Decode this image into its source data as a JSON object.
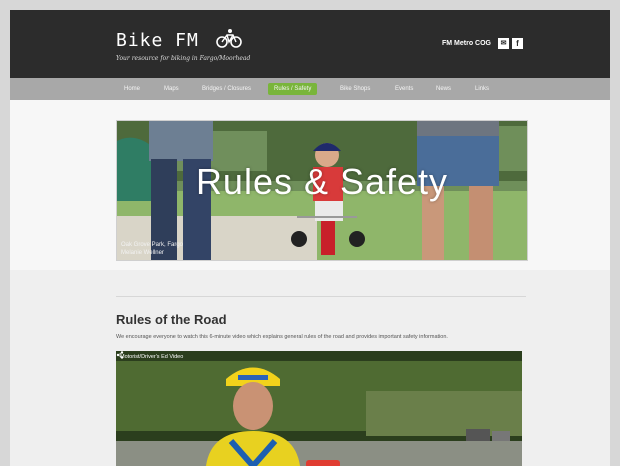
{
  "header": {
    "brand": "Bike FM",
    "tagline": "Your resource for biking in Fargo/Moorhead",
    "org": "FM Metro COG",
    "icons": [
      "bike-icon",
      "mail-icon",
      "facebook-icon"
    ],
    "social_mail_glyph": "✉",
    "social_fb_glyph": "f"
  },
  "nav": {
    "items": [
      {
        "label": "Home"
      },
      {
        "label": "Maps"
      },
      {
        "label": "Bridges / Closures"
      },
      {
        "label": "Rules / Safety"
      },
      {
        "label": "Bike Shops"
      },
      {
        "label": "Events"
      },
      {
        "label": "News"
      },
      {
        "label": "Links"
      }
    ],
    "active": "Rules / Safety",
    "active_color": "#79b53b"
  },
  "hero": {
    "title": "Rules & Safety",
    "caption_line1": "Oak Grove Park, Fargo",
    "caption_line2": "Melanie Wellner"
  },
  "content": {
    "section_title": "Rules of the Road",
    "section_text": "We encourage everyone to watch this 6-minute video which explains general rules of the road and provides important safety information.",
    "video": {
      "title": "Motorist/Driver's Ed Video"
    }
  }
}
